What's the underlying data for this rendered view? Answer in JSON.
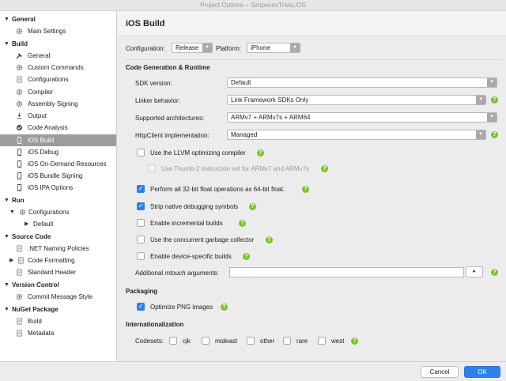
{
  "window": {
    "title": "Project Options – SimpsonsTrivia.iOS"
  },
  "sidebar": {
    "categories": [
      {
        "label": "General"
      },
      {
        "label": "Build"
      },
      {
        "label": "Run"
      },
      {
        "label": "Source Code"
      },
      {
        "label": "Version Control"
      },
      {
        "label": "NuGet Package"
      }
    ],
    "items": [
      {
        "label": "Main Settings",
        "icon": "gear-icon"
      },
      {
        "label": "General",
        "icon": "hammer-icon"
      },
      {
        "label": "Custom Commands",
        "icon": "gear-icon"
      },
      {
        "label": "Configurations",
        "icon": "document-icon"
      },
      {
        "label": "Compiler",
        "icon": "gear-icon"
      },
      {
        "label": "Assembly Signing",
        "icon": "gear-icon"
      },
      {
        "label": "Output",
        "icon": "output-icon"
      },
      {
        "label": "Code Analysis",
        "icon": "analysis-icon"
      },
      {
        "label": "iOS Build",
        "icon": "device-icon",
        "selected": true
      },
      {
        "label": "iOS Debug",
        "icon": "device-icon"
      },
      {
        "label": "iOS On-Demand Resources",
        "icon": "device-icon"
      },
      {
        "label": "iOS Bundle Signing",
        "icon": "device-icon"
      },
      {
        "label": "iOS IPA Options",
        "icon": "device-icon"
      },
      {
        "label": "Configurations",
        "icon": "gear-icon"
      },
      {
        "label": "Default",
        "icon": ""
      },
      {
        "label": ".NET Naming Policies",
        "icon": "document-icon"
      },
      {
        "label": "Code Formatting",
        "icon": "document-icon"
      },
      {
        "label": "Standard Header",
        "icon": "document-icon"
      },
      {
        "label": "Commit Message Style",
        "icon": "gear-icon"
      },
      {
        "label": "Build",
        "icon": "document-icon"
      },
      {
        "label": "Metadata",
        "icon": "document-icon"
      }
    ]
  },
  "main": {
    "header": "iOS Build",
    "configuration_label": "Configuration:",
    "configuration_value": "Release",
    "platform_label": "Platform:",
    "platform_value": "iPhone",
    "codegen": {
      "title": "Code Generation & Runtime",
      "sdk_label": "SDK version:",
      "sdk_value": "Default",
      "linker_label": "Linker behavior:",
      "linker_value": "Link Framework SDKs Only",
      "arch_label": "Supported architectures:",
      "arch_value": "ARMv7 + ARMv7s + ARM64",
      "http_label": "HttpClient implementation:",
      "http_value": "Managed",
      "llvm_label": "Use the LLVM optimizing compiler",
      "llvm_checked": false,
      "thumb_label": "Use Thumb-2 instruction set for ARMv7 and ARMv7s",
      "thumb_checked": false,
      "float_label": "Perform all 32-bit float operations as 64-bit float.",
      "float_checked": true,
      "strip_label": "Strip native debugging symbols",
      "strip_checked": true,
      "incremental_label": "Enable incremental builds",
      "incremental_checked": false,
      "gc_label": "Use the concurrent garbage collector",
      "gc_checked": false,
      "device_label": "Enable device-specific builds",
      "device_checked": false,
      "mtouch_label_prefix": "Additional ",
      "mtouch_label_em": "mtouch",
      "mtouch_label_suffix": " arguments:",
      "mtouch_value": "",
      "mtouch_button": "▸"
    },
    "packaging": {
      "title": "Packaging",
      "png_label": "Optimize PNG images",
      "png_checked": true
    },
    "i18n": {
      "title": "Internationalization",
      "codesets_label": "Codesets:",
      "codesets": [
        {
          "label": "cjk",
          "checked": false
        },
        {
          "label": "mideast",
          "checked": false
        },
        {
          "label": "other",
          "checked": false
        },
        {
          "label": "rare",
          "checked": false
        },
        {
          "label": "west",
          "checked": false
        }
      ]
    },
    "help_glyph": "?"
  },
  "footer": {
    "cancel_label": "Cancel",
    "ok_label": "OK"
  }
}
